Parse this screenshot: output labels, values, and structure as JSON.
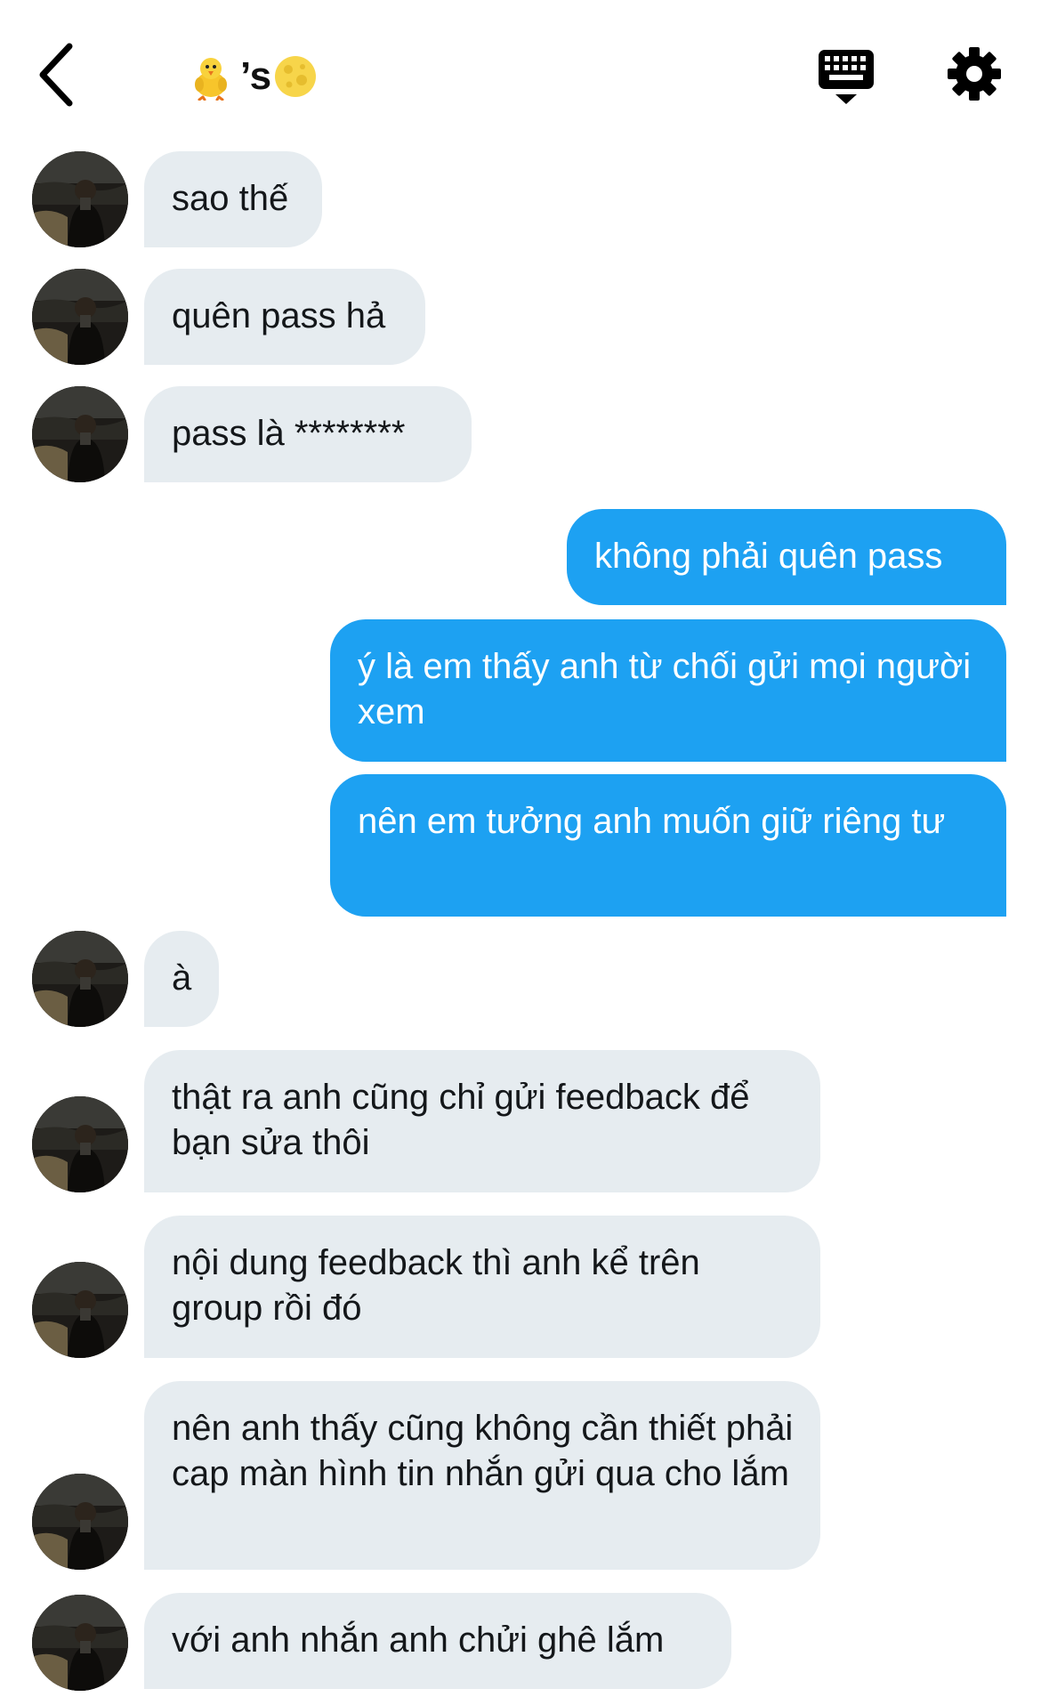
{
  "header": {
    "title_text": "’s",
    "icons": {
      "back": "chevron-left-icon",
      "title_prefix": "chick-emoji",
      "title_suffix": "full-moon-emoji",
      "keyboard": "keyboard-icon",
      "settings": "gear-icon"
    }
  },
  "messages": [
    {
      "side": "in",
      "text": "sao thế"
    },
    {
      "side": "in",
      "text": "quên pass hả"
    },
    {
      "side": "in",
      "text": "pass là ********"
    },
    {
      "side": "out",
      "text": "không phải quên pass"
    },
    {
      "side": "out",
      "text": "ý là em thấy anh từ chối gửi mọi người xem"
    },
    {
      "side": "out",
      "text": "nên em tưởng anh muốn giữ riêng tư"
    },
    {
      "side": "in",
      "text": "à"
    },
    {
      "side": "in",
      "text": "thật ra anh cũng chỉ gửi feedback để bạn sửa thôi"
    },
    {
      "side": "in",
      "text": "nội dung feedback thì anh kể trên group rồi đó"
    },
    {
      "side": "in",
      "text": "nên anh thấy cũng không cần thiết phải cap màn hình tin nhắn gửi qua cho lắm"
    },
    {
      "side": "in",
      "text": "với anh nhắn anh chửi ghê lắm"
    }
  ],
  "colors": {
    "incoming_bubble": "#e6ecf0",
    "outgoing_bubble": "#1da1f2",
    "text_dark": "#14171a",
    "text_light": "#ffffff"
  }
}
